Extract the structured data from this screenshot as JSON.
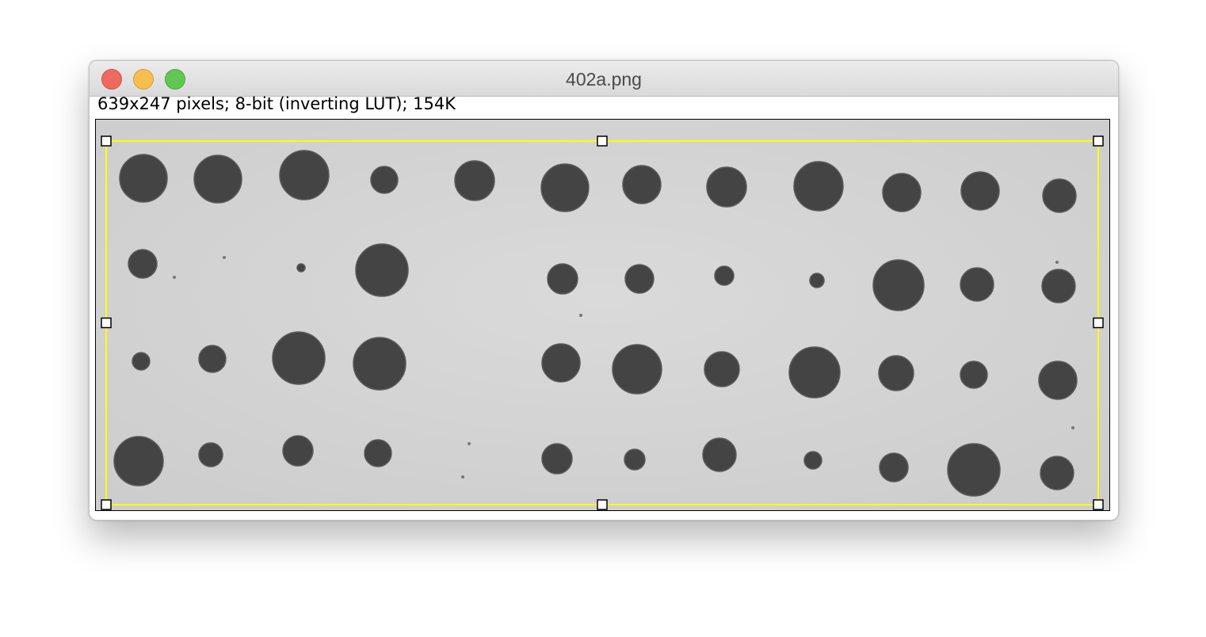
{
  "window": {
    "title": "402a.png",
    "info_text": "639x247 pixels; 8-bit (inverting LUT); 154K"
  },
  "controls": {
    "close": "close-button",
    "minimize": "minimize-button",
    "zoom": "zoom-button"
  },
  "colors": {
    "selection": "#ffff00",
    "spot": "#444444",
    "background": "#d4d4d4"
  },
  "image": {
    "description_icon": "colony-spots-image"
  }
}
